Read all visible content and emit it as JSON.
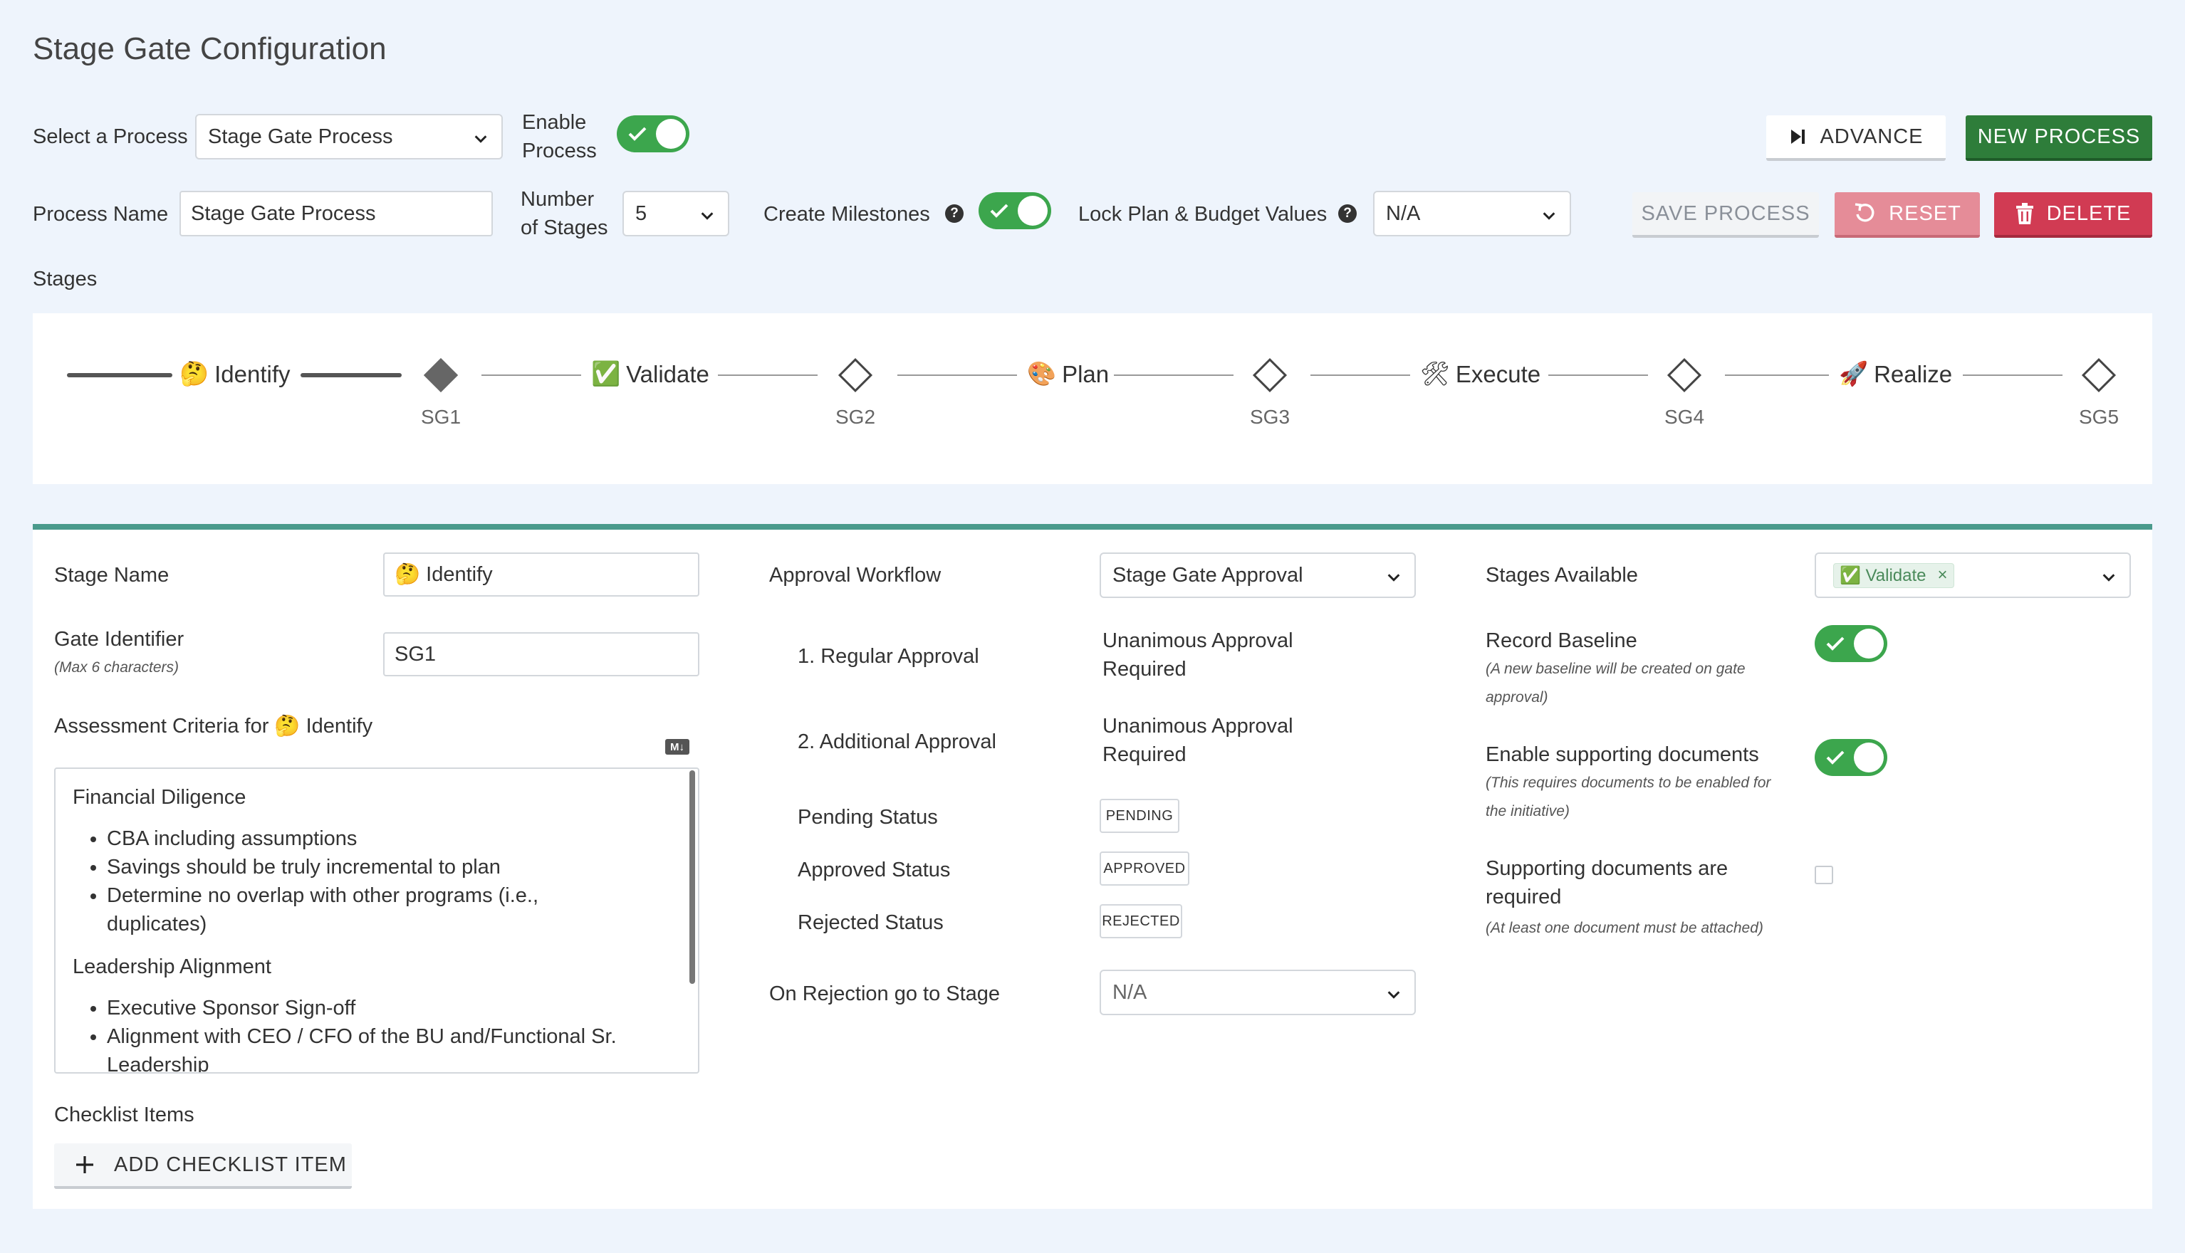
{
  "page": {
    "title": "Stage Gate Configuration"
  },
  "process_row": {
    "select_label": "Select a Process",
    "select_value": "Stage Gate Process",
    "enable_label_1": "Enable",
    "enable_label_2": "Process",
    "enable_on": true
  },
  "actions": {
    "advance": "ADVANCE",
    "new_process": "NEW PROCESS",
    "save_process": "SAVE PROCESS",
    "reset": "RESET",
    "delete": "DELETE"
  },
  "name_row": {
    "process_name_label": "Process Name",
    "process_name_value": "Stage Gate Process",
    "num_stages_label_1": "Number",
    "num_stages_label_2": "of Stages",
    "num_stages_value": "5",
    "create_milestones_label": "Create Milestones",
    "create_milestones_on": true,
    "lock_label": "Lock Plan & Budget Values",
    "lock_value": "N/A"
  },
  "stages_label": "Stages",
  "stages": [
    {
      "name": "Identify",
      "emoji": "🤔",
      "gate": "SG1"
    },
    {
      "name": "Validate",
      "emoji": "✅",
      "gate": "SG2"
    },
    {
      "name": "Plan",
      "emoji": "🎨",
      "gate": "SG3"
    },
    {
      "name": "Execute",
      "emoji": "🛠",
      "gate": "SG4"
    },
    {
      "name": "Realize",
      "emoji": "🚀",
      "gate": "SG5"
    }
  ],
  "detail": {
    "stage_name_label": "Stage Name",
    "stage_name_value": "🤔 Identify",
    "gate_identifier_label": "Gate Identifier",
    "gate_identifier_note": "(Max 6 characters)",
    "gate_identifier_value": "SG1",
    "assessment_label": "Assessment Criteria for 🤔 Identify",
    "markdown_icon": "M↓",
    "criteria": [
      {
        "heading": "Financial Diligence",
        "items": [
          "CBA including assumptions",
          "Savings should be truly incremental to plan",
          "Determine no overlap with other programs (i.e., duplicates)"
        ]
      },
      {
        "heading": "Leadership Alignment",
        "items": [
          "Executive Sponsor Sign-off",
          "Alignment with CEO / CFO of the BU and/Functional Sr. Leadership"
        ]
      }
    ],
    "checklist_label": "Checklist Items",
    "add_checklist": "ADD CHECKLIST ITEM",
    "approval_workflow_label": "Approval Workflow",
    "approval_workflow_value": "Stage Gate Approval",
    "regular_approval_label": "1. Regular Approval",
    "regular_approval_value_1": "Unanimous Approval",
    "regular_approval_value_2": "Required",
    "additional_approval_label": "2. Additional Approval",
    "additional_approval_value_1": "Unanimous Approval",
    "additional_approval_value_2": "Required",
    "pending_label": "Pending Status",
    "pending_badge": "PENDING",
    "approved_label": "Approved Status",
    "approved_badge": "APPROVED",
    "rejected_label": "Rejected Status",
    "rejected_badge": "REJECTED",
    "on_rejection_label": "On Rejection go to Stage",
    "on_rejection_value": "N/A",
    "stages_available_label": "Stages Available",
    "stages_available_chip": "✅ Validate",
    "record_baseline_label": "Record Baseline",
    "record_baseline_note_1": "(A new baseline will be created on gate",
    "record_baseline_note_2": "approval)",
    "enable_docs_label": "Enable supporting documents",
    "enable_docs_note_1": "(This requires documents to be enabled for",
    "enable_docs_note_2": "the initiative)",
    "docs_required_label_1": "Supporting documents are",
    "docs_required_label_2": "required",
    "docs_required_note": "(At least one document must be attached)"
  },
  "colors": {
    "accent_green": "#3ca64d",
    "new_process_green": "#2e7d3a",
    "delete_red": "#d13b53",
    "reset_pink": "#e58c98",
    "teal_border": "#4a9a8c"
  }
}
